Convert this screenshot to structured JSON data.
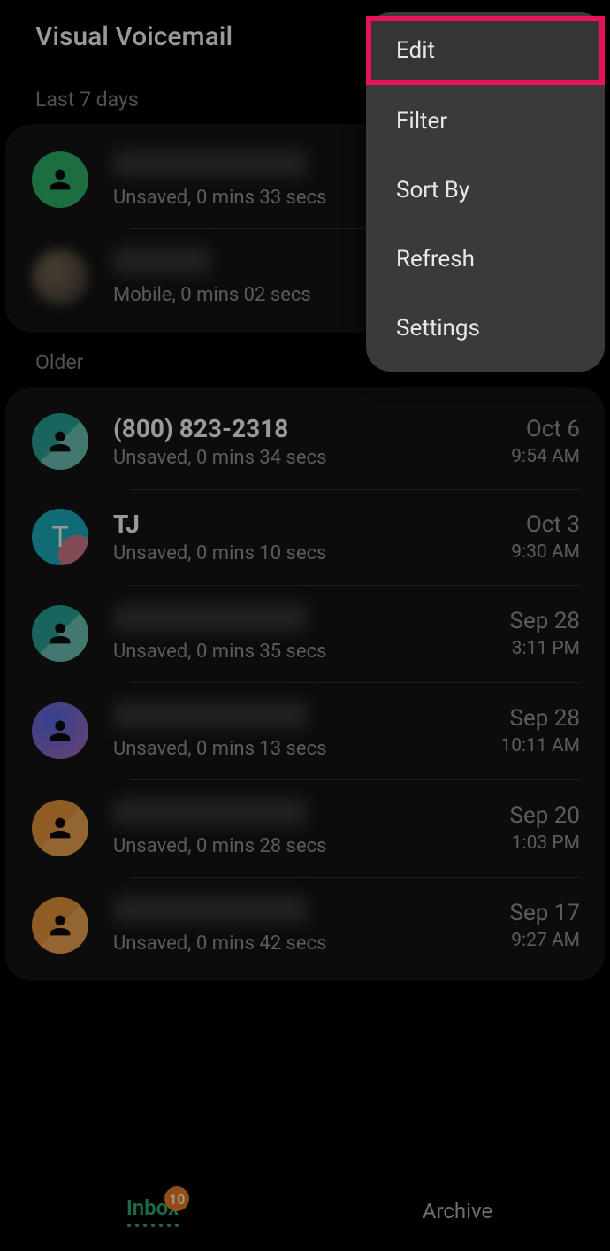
{
  "header": {
    "title": "Visual Voicemail"
  },
  "sections": {
    "recent_label": "Last 7 days",
    "older_label": "Older"
  },
  "menu": {
    "edit": "Edit",
    "filter": "Filter",
    "sort_by": "Sort By",
    "refresh": "Refresh",
    "settings": "Settings"
  },
  "recent": [
    {
      "title_blurred": true,
      "sub": "Unsaved, 0 mins 33 secs",
      "avatar": "green"
    },
    {
      "title_blurred": true,
      "title_short": true,
      "sub": "Mobile, 0 mins 02 secs",
      "avatar": "blurred"
    }
  ],
  "older": [
    {
      "title": "(800) 823-2318",
      "bold": true,
      "sub": "Unsaved, 0 mins 34 secs",
      "date": "Oct 6",
      "time": "9:54 AM",
      "avatar": "teal"
    },
    {
      "title": "TJ",
      "bold": true,
      "sub": "Unsaved, 0 mins 10 secs",
      "date": "Oct 3",
      "time": "9:30 AM",
      "avatar": "tj",
      "letter": "T"
    },
    {
      "title_blurred": true,
      "sub": "Unsaved, 0 mins 35 secs",
      "date": "Sep 28",
      "time": "3:11 PM",
      "avatar": "teal"
    },
    {
      "title_blurred": true,
      "sub": "Unsaved, 0 mins 13 secs",
      "date": "Sep 28",
      "time": "10:11 AM",
      "avatar": "purple"
    },
    {
      "title_blurred": true,
      "sub": "Unsaved, 0 mins 28 secs",
      "date": "Sep 20",
      "time": "1:03 PM",
      "avatar": "orange"
    },
    {
      "title_blurred": true,
      "sub": "Unsaved, 0 mins 42 secs",
      "date": "Sep 17",
      "time": "9:27 AM",
      "avatar": "orange"
    }
  ],
  "nav": {
    "inbox": "Inbox",
    "inbox_badge": "10",
    "archive": "Archive"
  }
}
